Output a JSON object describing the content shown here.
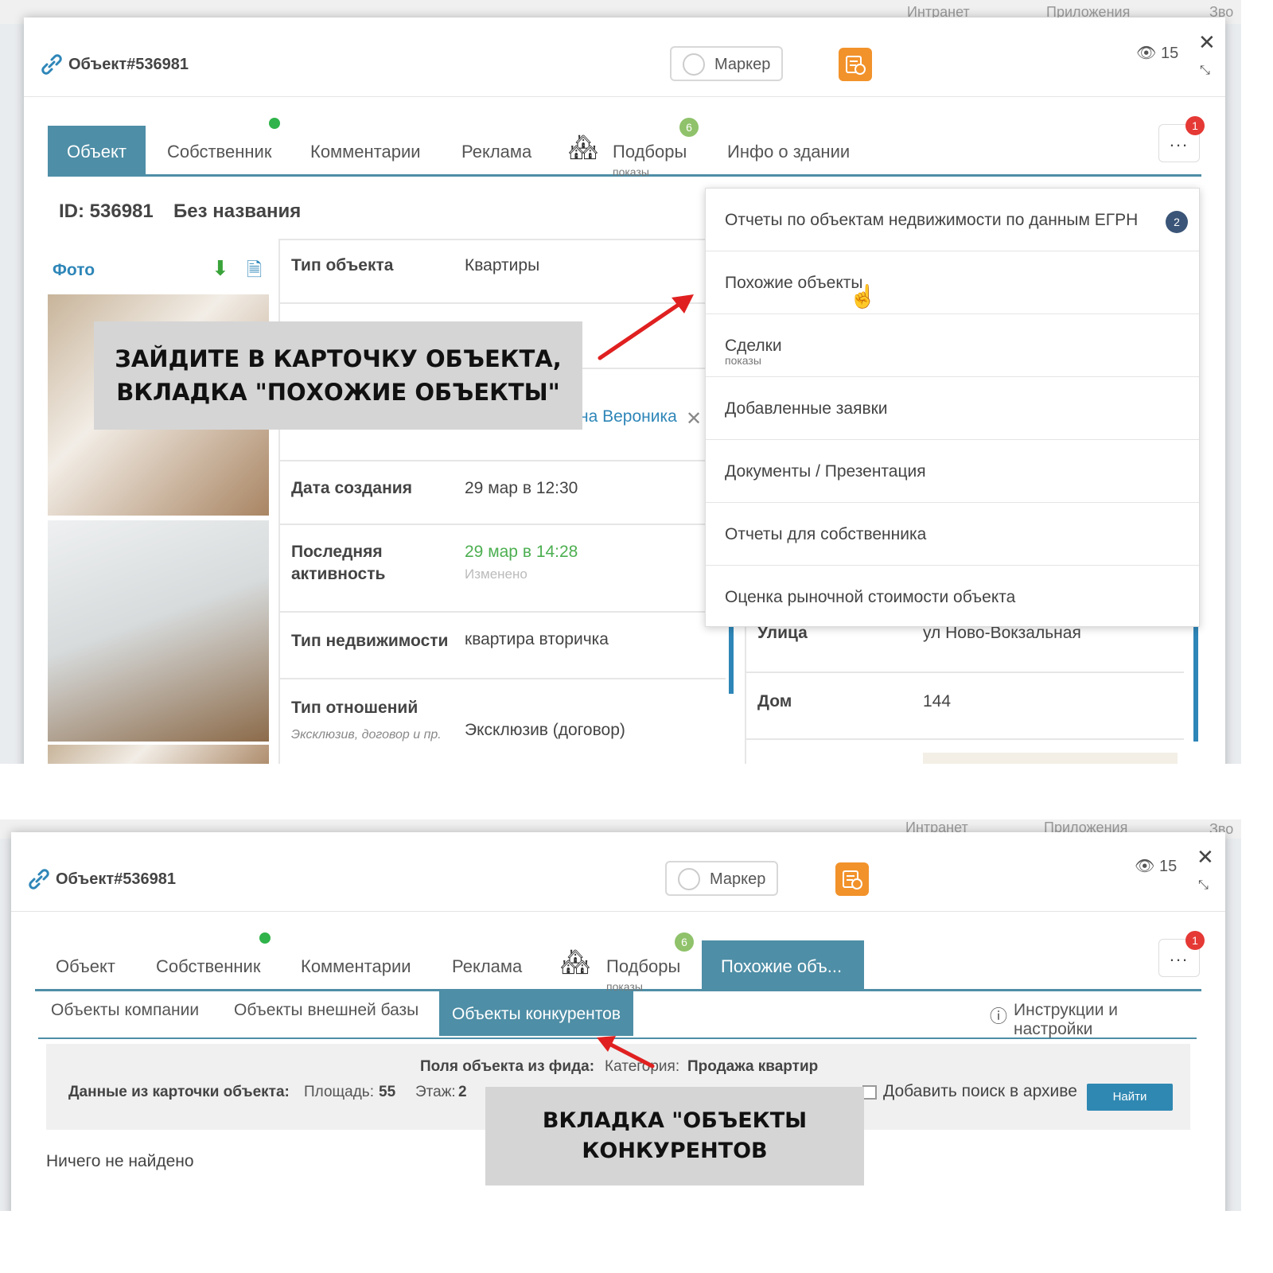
{
  "bg_items": [
    "Интранет",
    "Приложения",
    "Зво"
  ],
  "top": {
    "title": "Объект#536981",
    "marker_label": "Маркер",
    "views": "15",
    "tabs": [
      "Объект",
      "Собственник",
      "Комментарии",
      "Реклама",
      "Подборы",
      "Инфо о здании"
    ],
    "podbory_sub": "показы",
    "podbory_badge": "6",
    "more_badge": "1",
    "more_label": "...",
    "id_label": "ID: 536981",
    "name_label": "Без названия",
    "foto_label": "Фото",
    "rows": [
      {
        "k": "Тип объекта",
        "v": "Квартиры"
      },
      {
        "k": "Дата создания",
        "v": "29 мар в 12:30"
      },
      {
        "k": "Последняя активность",
        "v": "29 мар в 14:28",
        "v2": "Изменено"
      },
      {
        "k": "Тип недвижимости",
        "v": "квартира вторичка"
      },
      {
        "k": "Тип отношений",
        "hint": "Эксклюзив, договор и пр.",
        "v": "Эксклюзив (договор)"
      }
    ],
    "partial_person": "на Вероника",
    "right_rows": [
      {
        "k": "Улица",
        "v": "ул Ново-Вокзальная"
      },
      {
        "k": "Дом",
        "v": "144"
      }
    ],
    "menu": [
      {
        "label": "Отчеты по объектам недвижимости по данным ЕГРН",
        "badge": "2"
      },
      {
        "label": "Похожие объекты"
      },
      {
        "label": "Сделки",
        "sub": "показы"
      },
      {
        "label": "Добавленные заявки"
      },
      {
        "label": "Документы / Презентация"
      },
      {
        "label": "Отчеты для собственника"
      },
      {
        "label": "Оценка рыночной стоимости объекта"
      }
    ],
    "callout": [
      "ЗАЙДИТЕ В КАРТОЧКУ ОБЪЕКТА,",
      "ВКЛАДКА \"ПОХОЖИЕ ОБЪЕКТЫ\""
    ]
  },
  "bottom": {
    "title": "Объект#536981",
    "marker_label": "Маркер",
    "views": "15",
    "tabs": [
      "Объект",
      "Собственник",
      "Комментарии",
      "Реклама",
      "Подборы",
      "Похожие объ..."
    ],
    "podbory_sub": "показы",
    "podbory_badge": "6",
    "more_badge": "1",
    "more_label": "...",
    "subtabs": [
      "Объекты компании",
      "Объекты внешней базы",
      "Объекты конкурентов"
    ],
    "help_label": "Инструкции и настройки",
    "feed_label": "Поля объекта из фида:",
    "category_key": "Категория:",
    "category_val": "Продажа квартир",
    "card_label": "Данные из карточки объекта:",
    "area_key": "Площадь:",
    "area_val": "55",
    "floor_key": "Этаж:",
    "floor_val": "2",
    "archive_label": "Добавить поиск в архиве",
    "find_label": "Найти",
    "nothing_found": "Ничего не найдено",
    "callout": [
      "ВКЛАДКА \"ОБЪЕКТЫ",
      "КОНКУРЕНТОВ"
    ]
  },
  "colors": {
    "accent": "#4e8ea6",
    "orange": "#f2922b",
    "link": "#2e86b8",
    "green": "#4caf50",
    "arrow": "#e02020"
  }
}
